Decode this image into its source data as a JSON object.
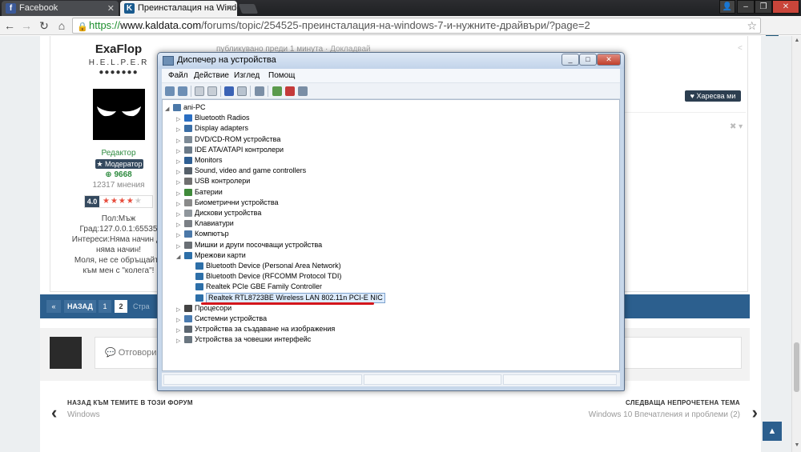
{
  "browser": {
    "tabs": [
      {
        "title": "Facebook",
        "icon": "facebook-icon",
        "active": false
      },
      {
        "title": "Преинсталация на Windo",
        "icon": "kaldata-icon",
        "active": true
      }
    ],
    "url_protocol": "https://",
    "url_host": "www.kaldata.com",
    "url_path": "/forums/topic/254525-преинсталация-на-windows-7-и-нужните-драйвъри/?page=2"
  },
  "profile": {
    "username": "ExaFlop",
    "rank": "H.E.L.P.E.R",
    "rank_dots": "●●●●●●●",
    "role": "Редактор",
    "badge": "★ Модератор",
    "reputation": "⊕ 9668",
    "opinions": "12317 мнения",
    "rating": "4.0",
    "stars_on": "★★★★",
    "stars_off": "★",
    "gender": "Пол:Мъж",
    "city": "Град:127.0.0.1:65535",
    "interests": "Интереси:Няма начин да няма начин!",
    "motto": "Моля, не се обръщайте към мен с \"колега\"!"
  },
  "post": {
    "time": "публикувано преди 1 минута",
    "report": "Докладвай",
    "like_label": "Харесва ми"
  },
  "pagination": {
    "first": "«",
    "prev": "НАЗАД",
    "pages": [
      "1",
      "2"
    ],
    "info": "Стра"
  },
  "reply": {
    "placeholder": "💬 Отговори н"
  },
  "nav": {
    "back_title": "НАЗАД КЪМ ТЕМИТЕ В ТОЗИ ФОРУМ",
    "back_sub": "Windows",
    "next_title": "СЛЕДВАЩА НЕПРОЧЕТЕНА ТЕМА",
    "next_sub": "Windows 10 Впечатления и проблеми (2)"
  },
  "device_manager": {
    "title": "Диспечер на устройства",
    "menus": [
      "Файл",
      "Действие",
      "Изглед",
      "Помощ"
    ],
    "root": "ani-PC",
    "categories": [
      {
        "label": "Bluetooth Radios",
        "icon": "bluetooth-icon",
        "color": "#2a6ec2"
      },
      {
        "label": "Display adapters",
        "icon": "display-icon",
        "color": "#3b6ea5"
      },
      {
        "label": "DVD/CD-ROM устройства",
        "icon": "dvd-icon",
        "color": "#7d8a96"
      },
      {
        "label": "IDE ATA/ATAPI контролери",
        "icon": "ide-icon",
        "color": "#6b7a88"
      },
      {
        "label": "Monitors",
        "icon": "monitor-icon",
        "color": "#2f5f93"
      },
      {
        "label": "Sound, video and game controllers",
        "icon": "sound-icon",
        "color": "#56606a"
      },
      {
        "label": "USB контролери",
        "icon": "usb-icon",
        "color": "#707070"
      },
      {
        "label": "Батерии",
        "icon": "battery-icon",
        "color": "#3f8a3a"
      },
      {
        "label": "Биометрични устройства",
        "icon": "biometric-icon",
        "color": "#8a8a8a"
      },
      {
        "label": "Дискови устройства",
        "icon": "disk-icon",
        "color": "#8f969c"
      },
      {
        "label": "Клавиатури",
        "icon": "keyboard-icon",
        "color": "#7a7f85"
      },
      {
        "label": "Компютър",
        "icon": "computer-icon",
        "color": "#4b78a8"
      },
      {
        "label": "Мишки и други посочващи устройства",
        "icon": "mouse-icon",
        "color": "#6a6f75"
      },
      {
        "label": "Мрежови карти",
        "icon": "network-icon",
        "color": "#2d6fa8"
      }
    ],
    "network_children": [
      "Bluetooth Device (Personal Area Network)",
      "Bluetooth Device (RFCOMM Protocol TDI)",
      "Realtek PCIe GBE Family Controller",
      "Realtek RTL8723BE Wireless LAN 802.11n PCI-E NIC"
    ],
    "after_categories": [
      {
        "label": "Процесори",
        "icon": "processor-icon",
        "color": "#444"
      },
      {
        "label": "Системни устройства",
        "icon": "system-icon",
        "color": "#4a7bb0"
      },
      {
        "label": "Устройства за създаване на изображения",
        "icon": "camera-icon",
        "color": "#5c6670"
      },
      {
        "label": "Устройства за човешки интерфейс",
        "icon": "hid-icon",
        "color": "#6a7680"
      }
    ]
  }
}
